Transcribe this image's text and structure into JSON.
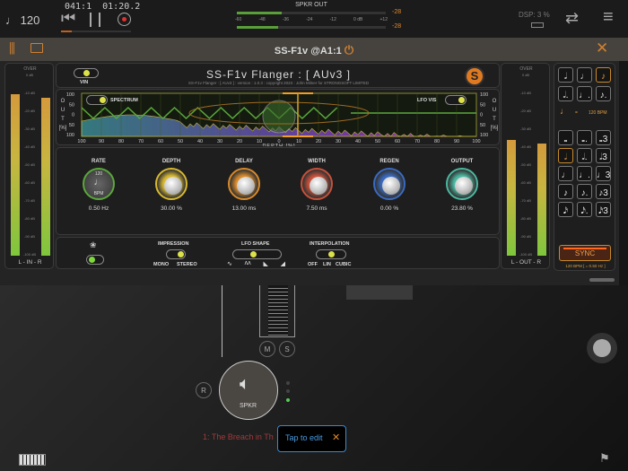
{
  "topbar": {
    "tempo": "♩ 120",
    "position": "041:1",
    "time": "01:20.2",
    "meter_title": "SPKR OUT",
    "meter_scale": [
      "-60",
      "-48",
      "-36",
      "-24",
      "-12",
      "0 dB",
      "+12"
    ],
    "peak_l": "-28",
    "peak_r": "-28",
    "dsp": "DSP: 3 %"
  },
  "plugin_header": {
    "title": "SS-F1v @A1:1"
  },
  "plugin": {
    "name": "SS-F1v Flanger : [ AUv3 ]",
    "subtitle": "SS-F1v Flanger : [ AUv3 ] : version : 1.0.3 : copyright 2023 : John Milner for STRONGSOFT LIMITED",
    "vin": "VIN",
    "logo": "S",
    "spectrum_label": "SPECTRUM",
    "lfo_vis_label": "LFO VIS",
    "out_label": [
      "O",
      "U",
      "T",
      "[%]"
    ],
    "y_ticks": [
      "100",
      "50",
      "0",
      "50",
      "100"
    ],
    "x_ticks": [
      "100",
      "90",
      "80",
      "70",
      "60",
      "50",
      "40",
      "30",
      "20",
      "10",
      "0",
      "10",
      "20",
      "30",
      "40",
      "50",
      "60",
      "70",
      "80",
      "90",
      "100"
    ],
    "x_label": "DEPTH [%]"
  },
  "knobs": [
    {
      "label": "RATE",
      "value": "0.50 Hz",
      "top": "120",
      "bottom": "BPM",
      "color": "#5aa83a",
      "level": 0.0
    },
    {
      "label": "DEPTH",
      "value": "30.00 %",
      "color": "#d8b830",
      "level": 0.3
    },
    {
      "label": "DELAY",
      "value": "13.00 ms",
      "color": "#d88a2a",
      "level": 0.0
    },
    {
      "label": "WIDTH",
      "value": "7.50 ms",
      "color": "#c8503a",
      "level": 0.4
    },
    {
      "label": "REGEN",
      "value": "0.00 %",
      "color": "#3a6ac0",
      "level": 0.0
    },
    {
      "label": "OUTPUT",
      "value": "23.80 %",
      "color": "#4ab8a0",
      "level": 0.5
    }
  ],
  "controls": {
    "impression": "IMPRESSION",
    "mono": "MONO",
    "stereo": "STEREO",
    "lfo_shape": "LFO SHAPE",
    "shapes": [
      "∿",
      "ʌʌ",
      "◣",
      "◢"
    ],
    "interpolation": "INTERPOLATION",
    "off": "OFF",
    "lin": "LIN",
    "cubic": "CUBIC"
  },
  "meters": {
    "over": "OVER",
    "scale": [
      "0 dB",
      "-10 dB",
      "-20 dB",
      "-30 dB",
      "-40 dB",
      "-50 dB",
      "-60 dB",
      "-70 dB",
      "-80 dB",
      "-90 dB",
      "-100 dB"
    ],
    "in_label": "L - IN - R",
    "out_label": "L - OUT - R",
    "in_level": [
      0.88,
      0.86
    ],
    "out_level": [
      0.63,
      0.61
    ]
  },
  "notes": {
    "top": [
      "𝅗𝅥",
      "♩",
      "♪",
      "𝅗𝅥.",
      "♩.",
      "♪."
    ],
    "top_selected": 2,
    "equals": "=",
    "bpm": "120 BPM",
    "grid": [
      "𝅝",
      "𝅝.",
      "𝅝3",
      "𝅗𝅥",
      "𝅗𝅥.",
      "𝅗𝅥3",
      "♩",
      "♩.",
      "♩3",
      "♪",
      "♪.",
      "♪3",
      "𝅘𝅥𝅯",
      "𝅘𝅥𝅯.",
      "𝅘𝅥𝅯3"
    ],
    "grid_selected": 3,
    "sync": "SYNC",
    "sync_info": "120 BPM [ = 0.50 Hz ]"
  },
  "mixer": {
    "m": "M",
    "s": "S",
    "r": "R",
    "node": "SPKR",
    "track": "1: The Breach in Th",
    "tooltip": "Tap to edit"
  }
}
